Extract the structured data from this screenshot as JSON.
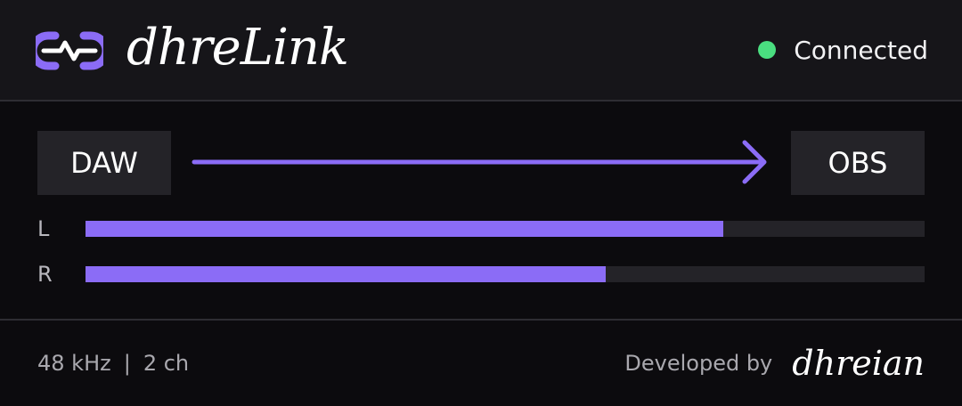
{
  "header": {
    "title": "dhreLink",
    "logo_icon": "link-pulse-icon",
    "status": {
      "text": "Connected",
      "color": "#4ade80"
    }
  },
  "routing": {
    "source": "DAW",
    "target": "OBS",
    "arrow_icon": "arrow-right-icon"
  },
  "meters": [
    {
      "label": "L",
      "level": 0.76
    },
    {
      "label": "R",
      "level": 0.62
    }
  ],
  "footer": {
    "sample_rate": "48 kHz",
    "separator": "|",
    "channels": "2 ch",
    "credit_label": "Developed by",
    "credit_name": "dhreian"
  },
  "colors": {
    "accent": "#8b6cf6",
    "status_ok": "#4ade80"
  }
}
